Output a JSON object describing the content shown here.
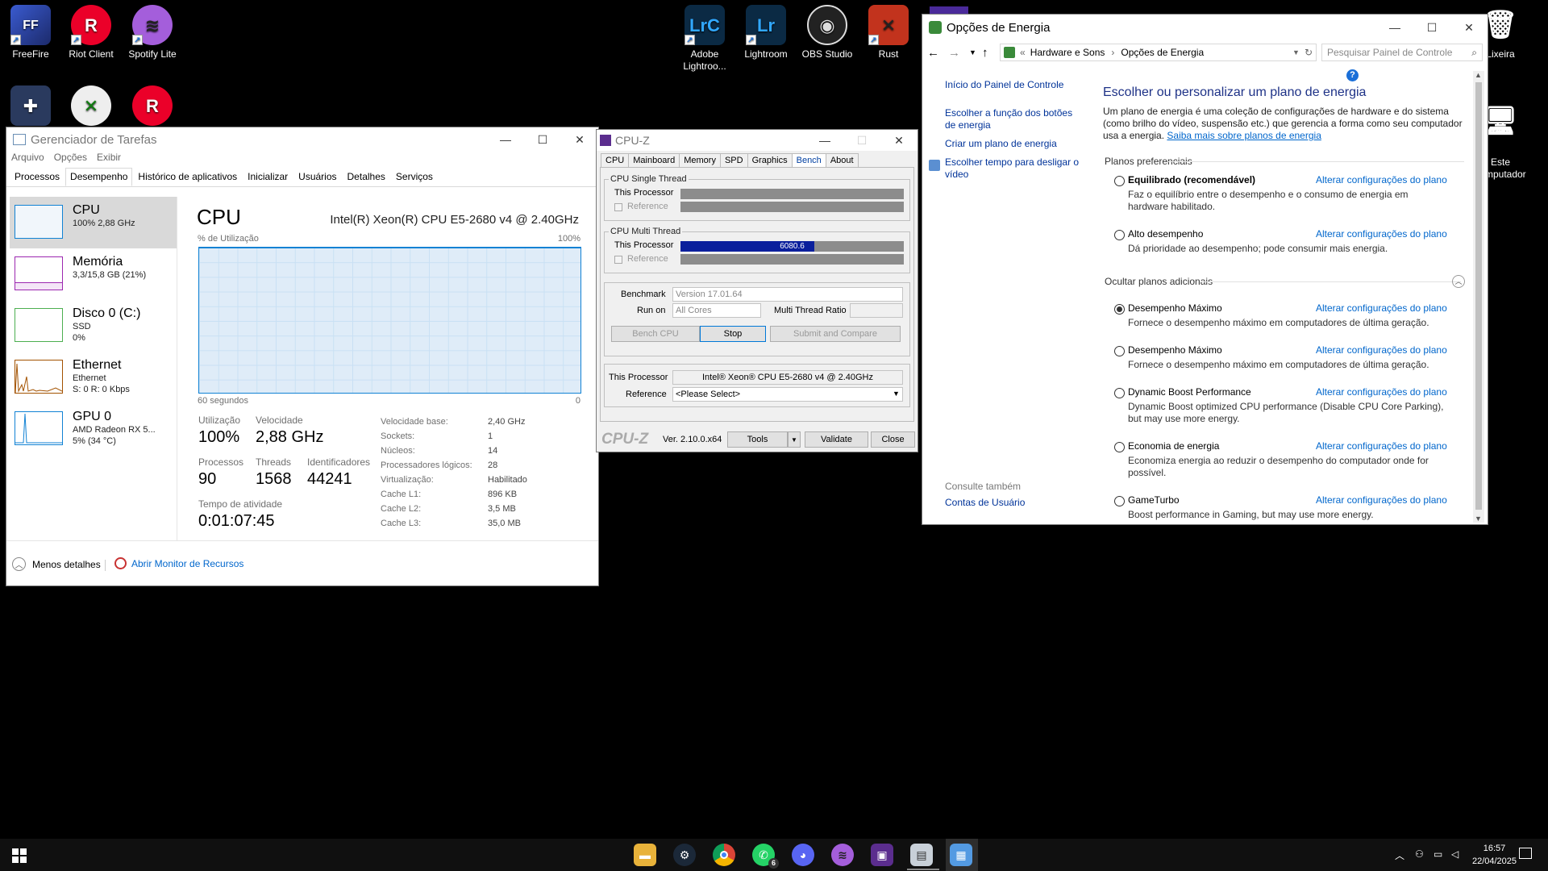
{
  "desktop_icons": [
    {
      "label": "FreeFire",
      "icon": "freefire-icon",
      "color": "#2b3a8a",
      "glyph": "FF"
    },
    {
      "label": "Riot Client",
      "icon": "riot-client-icon",
      "color": "#eb0029",
      "glyph": "R"
    },
    {
      "label": "Spotify Lite",
      "icon": "spotify-icon",
      "color": "#a45edb",
      "glyph": "≋"
    },
    {
      "label": "Adobe Lightroo...",
      "icon": "lightroom-classic-icon",
      "color": "#0b2a44",
      "glyph": "LrC"
    },
    {
      "label": "Lightroom",
      "icon": "lightroom-icon",
      "color": "#0b2a44",
      "glyph": "Lr"
    },
    {
      "label": "OBS Studio",
      "icon": "obs-studio-icon",
      "color": "#222",
      "glyph": "◉"
    },
    {
      "label": "Rust",
      "icon": "rust-icon",
      "color": "#c2331d",
      "glyph": "✕"
    },
    {
      "label": "Lixeira",
      "icon": "recycle-bin-icon",
      "color": "#cfd8e3",
      "glyph": "🗑"
    },
    {
      "label": "Este\ncomputador",
      "icon": "this-pc-icon",
      "color": "#6fb7e8",
      "glyph": "🖥"
    }
  ],
  "task_manager": {
    "title": "Gerenciador de Tarefas",
    "menu": [
      "Arquivo",
      "Opções",
      "Exibir"
    ],
    "tabs": [
      "Processos",
      "Desempenho",
      "Histórico de aplicativos",
      "Inicializar",
      "Usuários",
      "Detalhes",
      "Serviços"
    ],
    "active_tab": "Desempenho",
    "sidebar": [
      {
        "name": "CPU",
        "sub1": "100% 2,88 GHz",
        "sub2": "",
        "sub3": "",
        "color": "#1182d4"
      },
      {
        "name": "Memória",
        "sub1": "3,3/15,8 GB (21%)",
        "sub2": "",
        "sub3": "",
        "color": "#9c27b0"
      },
      {
        "name": "Disco 0 (C:)",
        "sub1": "SSD",
        "sub2": "0%",
        "sub3": "",
        "color": "#4caf50"
      },
      {
        "name": "Ethernet",
        "sub1": "Ethernet",
        "sub2": "S: 0 R: 0 Kbps",
        "sub3": "",
        "color": "#a35200"
      },
      {
        "name": "GPU 0",
        "sub1": "AMD Radeon RX 5...",
        "sub2": "5% (34 °C)",
        "sub3": "",
        "color": "#1182d4"
      }
    ],
    "heading": "CPU",
    "cpu_model": "Intel(R) Xeon(R) CPU E5-2680 v4 @ 2.40GHz",
    "util_label": "% de Utilização",
    "util_max": "100%",
    "time_label": "60 segundos",
    "time_min": "0",
    "utilization_percent": 100,
    "stats": {
      "util_label": "Utilização",
      "util": "100%",
      "speed_label": "Velocidade",
      "speed": "2,88 GHz",
      "proc_label": "Processos",
      "proc": "90",
      "threads_label": "Threads",
      "threads": "1568",
      "handles_label": "Identificadores",
      "handles": "44241",
      "uptime_label": "Tempo de atividade",
      "uptime": "0:01:07:45"
    },
    "details": [
      [
        "Velocidade base:",
        "2,40 GHz"
      ],
      [
        "Sockets:",
        "1"
      ],
      [
        "Núcleos:",
        "14"
      ],
      [
        "Processadores lógicos:",
        "28"
      ],
      [
        "Virtualização:",
        "Habilitado"
      ],
      [
        "Cache L1:",
        "896 KB"
      ],
      [
        "Cache L2:",
        "3,5 MB"
      ],
      [
        "Cache L3:",
        "35,0 MB"
      ]
    ],
    "fewer_details": "Menos detalhes",
    "open_monitor": "Abrir Monitor de Recursos"
  },
  "cpuz": {
    "title": "CPU-Z",
    "tabs": [
      "CPU",
      "Mainboard",
      "Memory",
      "SPD",
      "Graphics",
      "Bench",
      "About"
    ],
    "active_tab": "Bench",
    "single_thread_title": "CPU Single Thread",
    "multi_thread_title": "CPU Multi Thread",
    "this_processor": "This Processor",
    "reference": "Reference",
    "multi_score": "6080.6",
    "multi_fill_fraction": 0.6,
    "benchmark_label": "Benchmark",
    "benchmark_value": "Version 17.01.64",
    "run_on_label": "Run on",
    "run_on_value": "All Cores",
    "ratio_label": "Multi Thread Ratio",
    "bench_cpu": "Bench CPU",
    "stop": "Stop",
    "submit": "Submit and Compare",
    "proc_label": "This Processor",
    "proc_value": "Intel® Xeon® CPU E5-2680 v4 @ 2.40GHz",
    "ref_label": "Reference",
    "ref_value": "<Please Select>",
    "logo": "CPU-Z",
    "version": "Ver. 2.10.0.x64",
    "tools": "Tools",
    "validate": "Validate",
    "close": "Close"
  },
  "power": {
    "title": "Opções de Energia",
    "breadcrumb": [
      "Hardware e Sons",
      "Opções de Energia"
    ],
    "search_placeholder": "Pesquisar Painel de Controle",
    "left_links": [
      "Início do Painel de Controle",
      "Escolher a função dos botões de energia",
      "Criar um plano de energia",
      "Escolher tempo para desligar o vídeo"
    ],
    "see_also": "Consulte também",
    "user_accounts": "Contas de Usuário",
    "heading": "Escolher ou personalizar um plano de energia",
    "intro": "Um plano de energia é uma coleção de configurações de hardware e do sistema (como brilho do vídeo, suspensão etc.) que gerencia a forma como seu computador usa a energia.",
    "learn_more": "Saiba mais sobre planos de energia",
    "preferred": "Planos preferenciais",
    "hidden": "Ocultar planos adicionais",
    "change": "Alterar configurações do plano",
    "plans": [
      {
        "name": "Equilibrado (recomendável)",
        "desc": "Faz o equilíbrio entre o desempenho e o consumo de energia em hardware habilitado.",
        "selected": false,
        "bold": true
      },
      {
        "name": "Alto desempenho",
        "desc": "Dá prioridade ao desempenho; pode consumir mais energia.",
        "selected": false,
        "bold": false
      },
      {
        "name": "Desempenho Máximo",
        "desc": "Fornece o desempenho máximo em computadores de última geração.",
        "selected": true,
        "bold": false
      },
      {
        "name": "Desempenho Máximo",
        "desc": "Fornece o desempenho máximo em computadores de última geração.",
        "selected": false,
        "bold": false
      },
      {
        "name": "Dynamic Boost Performance",
        "desc": "Dynamic Boost optimized CPU performance (Disable CPU Core Parking), but may use more energy.",
        "selected": false,
        "bold": false
      },
      {
        "name": "Economia de energia",
        "desc": "Economiza energia ao reduzir o desempenho do computador onde for possível.",
        "selected": false,
        "bold": false
      },
      {
        "name": "GameTurbo",
        "desc": "Boost performance in Gaming, but may use more energy.",
        "selected": false,
        "bold": false
      }
    ]
  },
  "taskbar": {
    "time": "16:57",
    "date": "22/04/2025",
    "whatsapp_badge": "6",
    "icons": [
      "file-explorer-icon",
      "steam-icon",
      "chrome-icon",
      "whatsapp-icon",
      "discord-icon",
      "spotify-icon",
      "cpuz-icon",
      "task-manager-icon",
      "control-panel-icon"
    ]
  }
}
